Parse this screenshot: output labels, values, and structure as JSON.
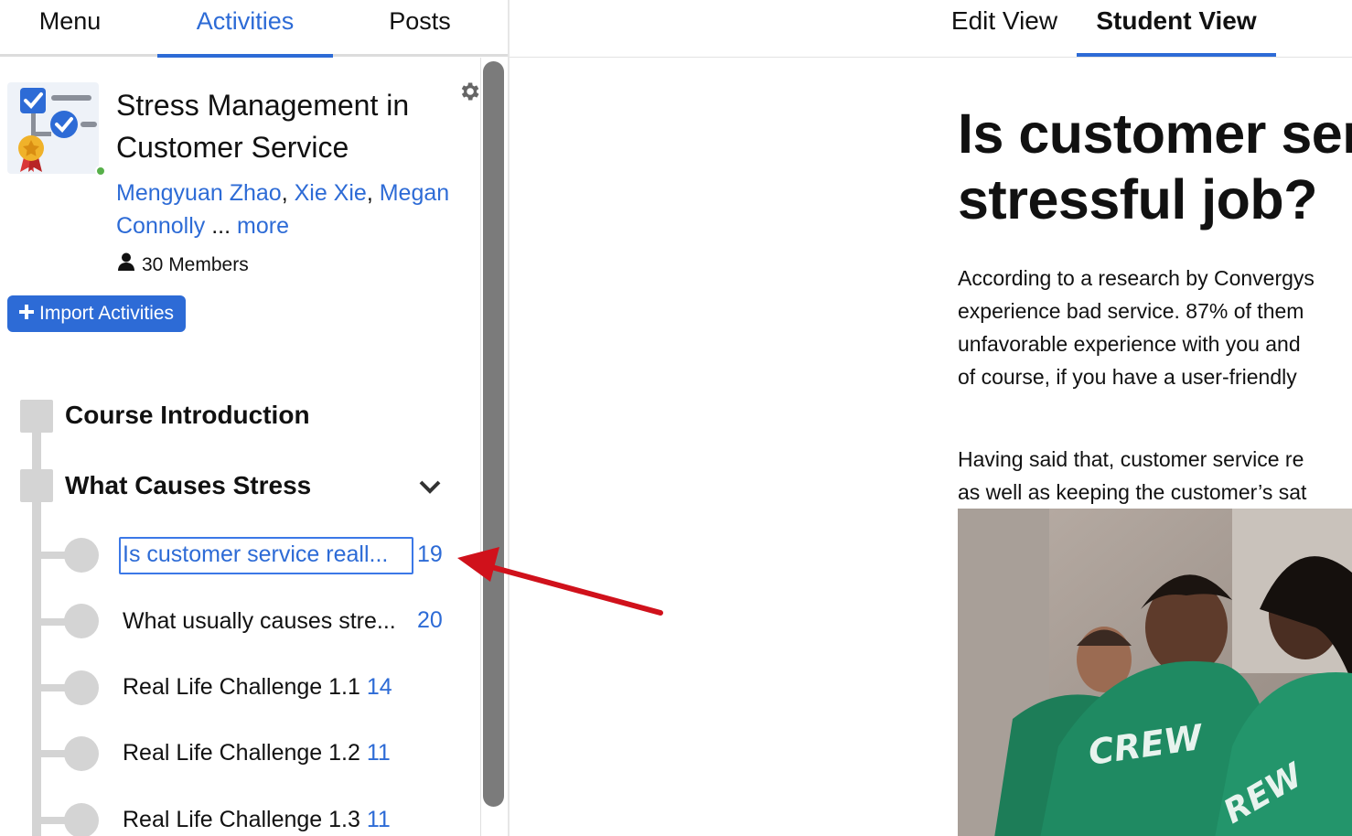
{
  "left_tabs": [
    {
      "label": "Menu"
    },
    {
      "label": "Activities"
    },
    {
      "label": "Posts"
    }
  ],
  "course": {
    "title": "Stress Management in Customer Service",
    "authors": [
      "Mengyuan Zhao",
      "Xie Xie",
      "Megan Connolly"
    ],
    "author_sep": ", ",
    "ellipsis": " ... ",
    "more_label": "more",
    "members_label": "30 Members",
    "import_label": "Import Activities"
  },
  "sections": [
    {
      "label": "Course Introduction"
    },
    {
      "label": "What Causes Stress"
    }
  ],
  "activities": [
    {
      "label": "Is customer service reall...",
      "count": "19"
    },
    {
      "label": "What usually causes stre...",
      "count": "20"
    },
    {
      "label": "Real Life Challenge 1.1",
      "count": "14"
    },
    {
      "label": "Real Life Challenge 1.2",
      "count": "11"
    },
    {
      "label": "Real Life Challenge 1.3",
      "count": "11"
    }
  ],
  "right_tabs": [
    {
      "label": "Edit View"
    },
    {
      "label": "Student View"
    }
  ],
  "article": {
    "title_line1": "Is customer ser",
    "title_line2": "stressful job?",
    "para1": [
      "According to a research by Convergys",
      "experience bad service. 87% of them",
      "unfavorable experience with you and",
      "of course, if you have a user-friendly"
    ],
    "para2": [
      "Having said that, customer service re",
      "as well as keeping the customer’s sat"
    ],
    "shirt_text_1": "CREW",
    "shirt_text_2": "REW"
  },
  "colors": {
    "accent": "#2d6bd6",
    "tree": "#d4d4d4",
    "online": "#57b04a",
    "arrow": "#d0111b",
    "shirt": "#1f8a62"
  },
  "icons": [
    "gear-icon",
    "user-icon",
    "plus-icon",
    "chevron-down-icon",
    "course-checklist-icon",
    "annotation-arrow"
  ]
}
